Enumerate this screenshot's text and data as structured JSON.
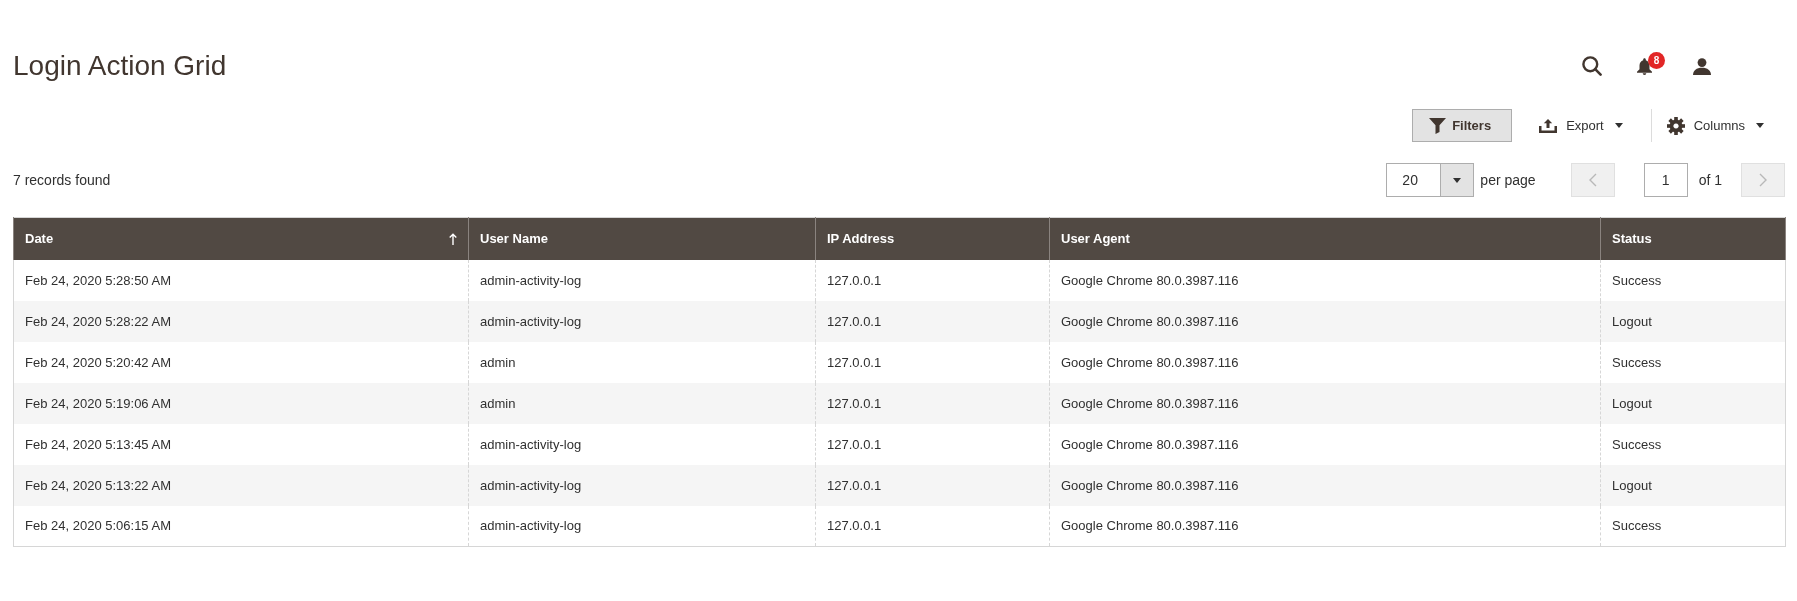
{
  "page": {
    "title": "Login Action Grid",
    "notifications": "8"
  },
  "toolbar": {
    "filters": "Filters",
    "export": "Export",
    "columns": "Columns"
  },
  "pager": {
    "records_found": "7 records found",
    "per_page": {
      "value": "20",
      "label": "per page"
    },
    "previous": {
      "disabled": true
    },
    "page": {
      "value": "1",
      "total": "of 1"
    },
    "next": {
      "disabled": true
    }
  },
  "table": {
    "columns": [
      {
        "label": "Date",
        "sorted": true
      },
      {
        "label": "User Name",
        "sorted": false
      },
      {
        "label": "IP Address",
        "sorted": false
      },
      {
        "label": "User Agent",
        "sorted": false
      },
      {
        "label": "Status",
        "sorted": false
      }
    ],
    "rows": [
      [
        "Feb 24, 2020 5:28:50 AM",
        "admin-activity-log",
        "127.0.0.1",
        "Google Chrome 80.0.3987.116",
        "Success"
      ],
      [
        "Feb 24, 2020 5:28:22 AM",
        "admin-activity-log",
        "127.0.0.1",
        "Google Chrome 80.0.3987.116",
        "Logout"
      ],
      [
        "Feb 24, 2020 5:20:42 AM",
        "admin",
        "127.0.0.1",
        "Google Chrome 80.0.3987.116",
        "Success"
      ],
      [
        "Feb 24, 2020 5:19:06 AM",
        "admin",
        "127.0.0.1",
        "Google Chrome 80.0.3987.116",
        "Logout"
      ],
      [
        "Feb 24, 2020 5:13:45 AM",
        "admin-activity-log",
        "127.0.0.1",
        "Google Chrome 80.0.3987.116",
        "Success"
      ],
      [
        "Feb 24, 2020 5:13:22 AM",
        "admin-activity-log",
        "127.0.0.1",
        "Google Chrome 80.0.3987.116",
        "Logout"
      ],
      [
        "Feb 24, 2020 5:06:15 AM",
        "admin-activity-log",
        "127.0.0.1",
        "Google Chrome 80.0.3987.116",
        "Success"
      ]
    ]
  }
}
